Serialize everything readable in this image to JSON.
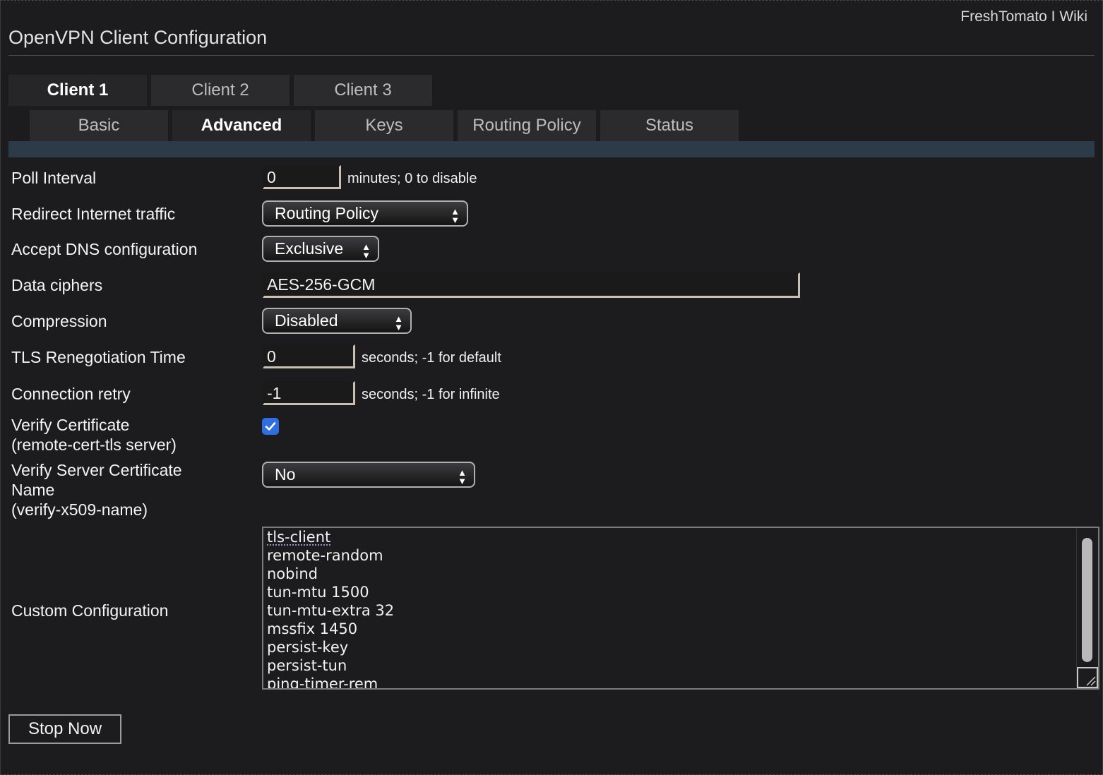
{
  "header": {
    "links": [
      "FreshTomato",
      "Wiki"
    ],
    "separator": "I",
    "title": "OpenVPN Client Configuration"
  },
  "client_tabs": [
    {
      "label": "Client 1",
      "active": true
    },
    {
      "label": "Client 2",
      "active": false
    },
    {
      "label": "Client 3",
      "active": false
    }
  ],
  "section_tabs": [
    {
      "label": "Basic",
      "active": false
    },
    {
      "label": "Advanced",
      "active": true
    },
    {
      "label": "Keys",
      "active": false
    },
    {
      "label": "Routing Policy",
      "active": false
    },
    {
      "label": "Status",
      "active": false
    }
  ],
  "form": {
    "poll_interval": {
      "label": "Poll Interval",
      "value": "0",
      "hint": "minutes; 0 to disable"
    },
    "redirect_internet": {
      "label": "Redirect Internet traffic",
      "selected": "Routing Policy"
    },
    "accept_dns": {
      "label": "Accept DNS configuration",
      "selected": "Exclusive"
    },
    "data_ciphers": {
      "label": "Data ciphers",
      "value": "AES-256-GCM"
    },
    "compression": {
      "label": "Compression",
      "selected": "Disabled"
    },
    "tls_reneg": {
      "label": "TLS Renegotiation Time",
      "value": "0",
      "hint": "seconds; -1 for default"
    },
    "connection_retry": {
      "label": "Connection retry",
      "value": "-1",
      "hint": "seconds; -1 for infinite"
    },
    "verify_cert": {
      "label_line1": "Verify Certificate",
      "label_line2": "(remote-cert-tls server)",
      "checked": true
    },
    "verify_server_name": {
      "label_line1": "Verify Server Certificate",
      "label_line2": "Name",
      "label_line3": "(verify-x509-name)",
      "selected": "No"
    },
    "custom_config": {
      "label": "Custom Configuration",
      "lines": [
        "tls-client",
        "remote-random",
        "nobind",
        "tun-mtu 1500",
        "tun-mtu-extra 32",
        "mssfix 1450",
        "persist-key",
        "persist-tun",
        "ping-timer-rem"
      ]
    }
  },
  "buttons": {
    "stop": "Stop Now"
  },
  "colors": {
    "background": "#1c1c1e",
    "tab": "#2b2b2d",
    "subbar": "#2d3a48",
    "checkbox": "#2f6fe0",
    "input_border": "#c9bfb3"
  }
}
